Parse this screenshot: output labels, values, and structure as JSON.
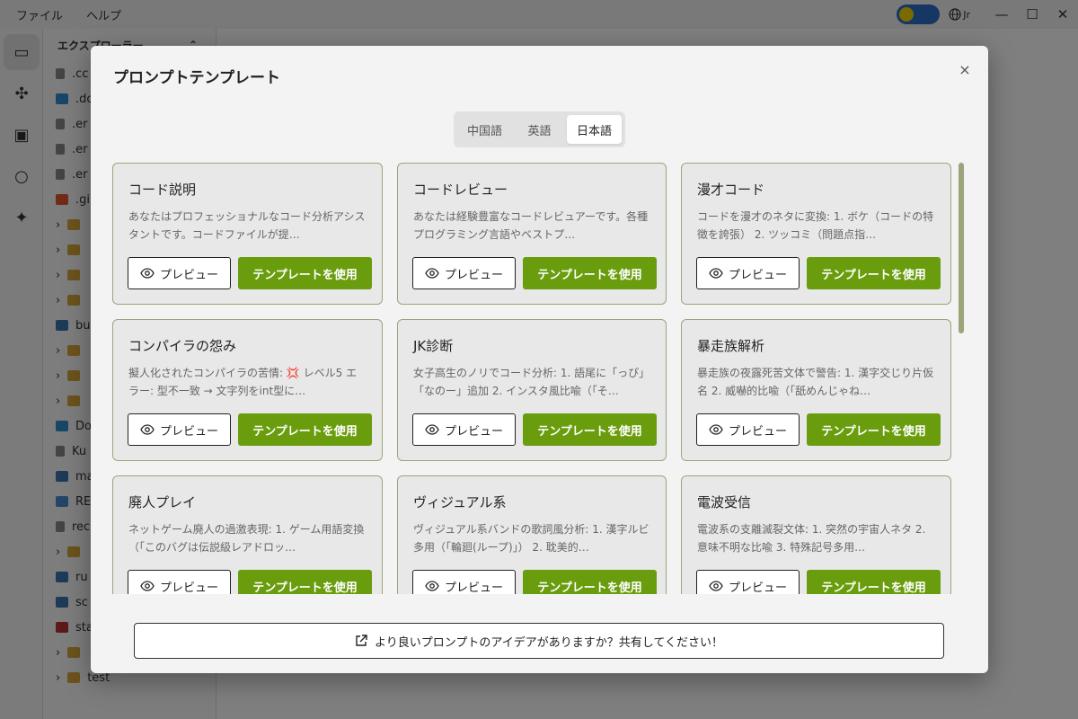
{
  "menu": [
    "ファイル",
    "ヘルプ"
  ],
  "window": {
    "lang_indicator": "Jr",
    "minimize": "—",
    "maximize": "☐",
    "close": "✕"
  },
  "explorer": {
    "title": "エクスプローラー",
    "items": [
      {
        "label": ".cc",
        "icon": "file"
      },
      {
        "label": ".do",
        "icon": "docker"
      },
      {
        "label": ".er",
        "icon": "file"
      },
      {
        "label": ".er",
        "icon": "file"
      },
      {
        "label": ".er",
        "icon": "file"
      },
      {
        "label": ".gi",
        "icon": "git"
      },
      {
        "label": "",
        "icon": "folder"
      },
      {
        "label": "",
        "icon": "folder"
      },
      {
        "label": "",
        "icon": "folder"
      },
      {
        "label": "",
        "icon": "folder"
      },
      {
        "label": "bu",
        "icon": "py"
      },
      {
        "label": "",
        "icon": "folder"
      },
      {
        "label": "",
        "icon": "folder"
      },
      {
        "label": "",
        "icon": "folder"
      },
      {
        "label": "Do",
        "icon": "docker"
      },
      {
        "label": "Ku",
        "icon": "file"
      },
      {
        "label": "ma",
        "icon": "py"
      },
      {
        "label": "RE",
        "icon": "md"
      },
      {
        "label": "rec",
        "icon": "file"
      },
      {
        "label": "",
        "icon": "folder"
      },
      {
        "label": "ru",
        "icon": "py"
      },
      {
        "label": "sc",
        "icon": "py"
      },
      {
        "label": "sta",
        "icon": "sh"
      },
      {
        "label": "",
        "icon": "folder"
      },
      {
        "label": "test",
        "icon": "folder"
      }
    ]
  },
  "modal": {
    "title": "プロンプトテンプレート",
    "close_icon": "×",
    "tabs": [
      {
        "label": "中国語",
        "active": false
      },
      {
        "label": "英語",
        "active": false
      },
      {
        "label": "日本語",
        "active": true
      }
    ],
    "preview_label": "プレビュー",
    "use_label": "テンプレートを使用",
    "cards": [
      {
        "title": "コード説明",
        "desc": "あなたはプロフェッショナルなコード分析アシスタントです。コードファイルが提…"
      },
      {
        "title": "コードレビュー",
        "desc": "あなたは経験豊富なコードレビュアーです。各種プログラミング言語やベストプ…"
      },
      {
        "title": "漫才コード",
        "desc": "コードを漫才のネタに変換: 1. ボケ（コードの特徴を誇張） 2. ツッコミ（問題点指…"
      },
      {
        "title": "コンパイラの怨み",
        "desc": "擬人化されたコンパイラの苦情: 💢 レベル5 エラー: 型不一致 → 文字列をint型に…"
      },
      {
        "title": "JK診断",
        "desc": "女子高生のノリでコード分析: 1. 語尾に「っぴ」「なのー」追加 2. インスタ風比喩（「そ…"
      },
      {
        "title": "暴走族解析",
        "desc": "暴走族の夜露死苦文体で警告: 1. 漢字交じり片仮名 2. 威嚇的比喩（「舐めんじゃね…"
      },
      {
        "title": "廃人プレイ",
        "desc": "ネットゲーム廃人の過激表現: 1. ゲーム用語変換（「このバグは伝説級レアドロッ…"
      },
      {
        "title": "ヴィジュアル系",
        "desc": "ヴィジュアル系バンドの歌詞風分析: 1. 漢字ルビ多用（「輪廻(ループ)」） 2. 耽美的…"
      },
      {
        "title": "電波受信",
        "desc": "電波系の支離滅裂文体: 1. 突然の宇宙人ネタ 2. 意味不明な比喩 3. 特殊記号多用…"
      }
    ],
    "share_label": "より良いプロンプトのアイデアがありますか？共有してください！"
  },
  "colors": {
    "accent": "#6a9d0e",
    "card_border": "#9aa57a",
    "toggle": "#2d6ec9"
  }
}
